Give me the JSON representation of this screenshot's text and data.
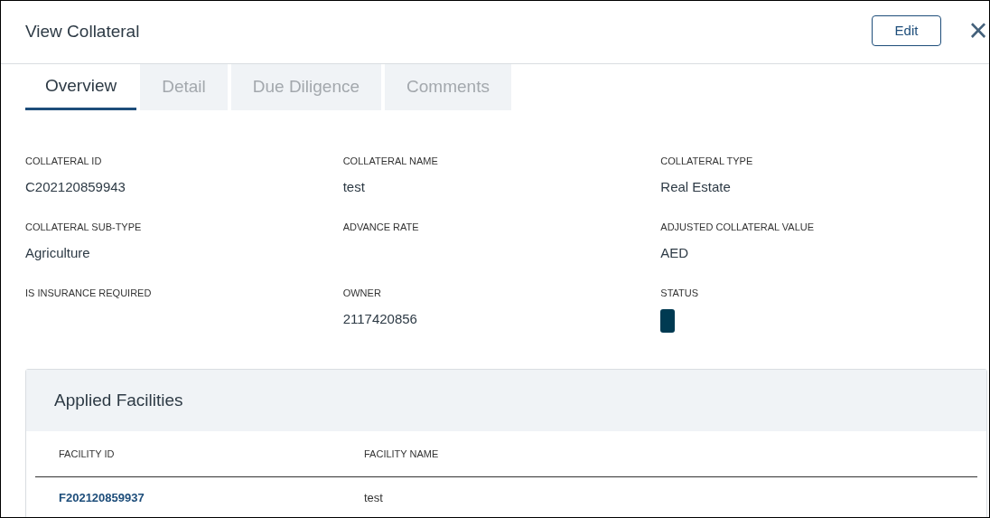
{
  "dialog": {
    "title": "View Collateral",
    "edit_button": "Edit",
    "close": "×"
  },
  "tabs": [
    {
      "label": "Overview",
      "selected": true
    },
    {
      "label": "Detail",
      "selected": false
    },
    {
      "label": "Due Diligence",
      "selected": false
    },
    {
      "label": "Comments",
      "selected": false
    }
  ],
  "fields": [
    {
      "label": "COLLATERAL ID",
      "kind": "text",
      "value": "C202120859943"
    },
    {
      "label": "COLLATERAL NAME",
      "kind": "text",
      "value": "test"
    },
    {
      "label": "COLLATERAL TYPE",
      "kind": "text",
      "value": "Real Estate"
    },
    {
      "label": "COLLATERAL SUB-TYPE",
      "kind": "text",
      "value": "Agriculture"
    },
    {
      "label": "ADVANCE RATE",
      "kind": "text"
    },
    {
      "label": "ADJUSTED COLLATERAL VALUE",
      "kind": "text",
      "value": "AED"
    },
    {
      "label": "IS INSURANCE REQUIRED",
      "kind": "text"
    },
    {
      "label": "OWNER",
      "kind": "text",
      "value": "2117420856"
    },
    {
      "label": "STATUS",
      "kind": "badge"
    }
  ],
  "applied_facilities": {
    "title": "Applied Facilities",
    "columns": [
      "FACILITY ID",
      "FACILITY NAME"
    ],
    "rows": [
      {
        "facility_id": "F202120859937",
        "facility_name": "test"
      }
    ]
  }
}
